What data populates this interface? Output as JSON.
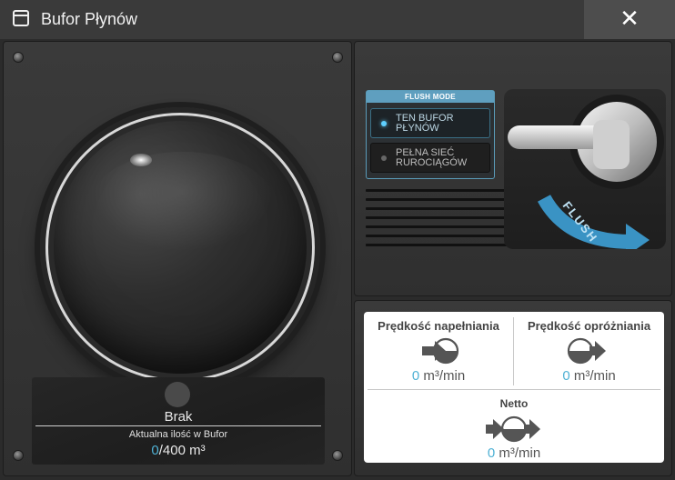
{
  "window": {
    "title": "Bufor Płynów",
    "close_label": "✕",
    "window_icon": "window-icon",
    "close_icon": "close-icon"
  },
  "tank": {
    "status": "Brak",
    "amount_label": "Aktualna ilość w Bufor",
    "amount_current": "0",
    "amount_max": "/400 m³",
    "fill_fraction": 0
  },
  "flush": {
    "mode_header": "FLUSH MODE",
    "options": [
      {
        "label": "TEN BUFOR PŁYNÓW",
        "selected": true
      },
      {
        "label": "PEŁNA SIEĆ RUROCIĄGÓW",
        "selected": false
      }
    ],
    "lever_label": "FLUSH"
  },
  "rates": {
    "fill": {
      "title": "Prędkość napełniania",
      "value": "0",
      "unit": " m³/min"
    },
    "drain": {
      "title": "Prędkość opróżniania",
      "value": "0",
      "unit": " m³/min"
    },
    "net": {
      "title": "Netto",
      "value": "0",
      "unit": " m³/min"
    }
  },
  "colors": {
    "accent": "#4fb1d4",
    "flush_header": "#5f9fbf",
    "led_on": "#5fd0ff",
    "led_off": "#666666"
  }
}
